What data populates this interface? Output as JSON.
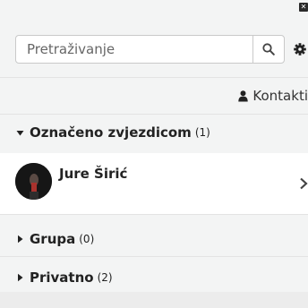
{
  "search": {
    "placeholder": "Pretraživanje"
  },
  "header": {
    "contacts_label": "Kontakti"
  },
  "groups": [
    {
      "label": "Označeno zvjezdicom",
      "count": "(1)"
    },
    {
      "label": "Grupa",
      "count": "(0)"
    },
    {
      "label": "Privatno",
      "count": "(2)"
    }
  ],
  "starred_contacts": [
    {
      "name": "Jure Širić"
    }
  ],
  "icons": {
    "close": "close-icon",
    "search": "search-icon",
    "settings": "gear-icon",
    "user": "user-icon",
    "expand": "chevron-right-icon"
  }
}
